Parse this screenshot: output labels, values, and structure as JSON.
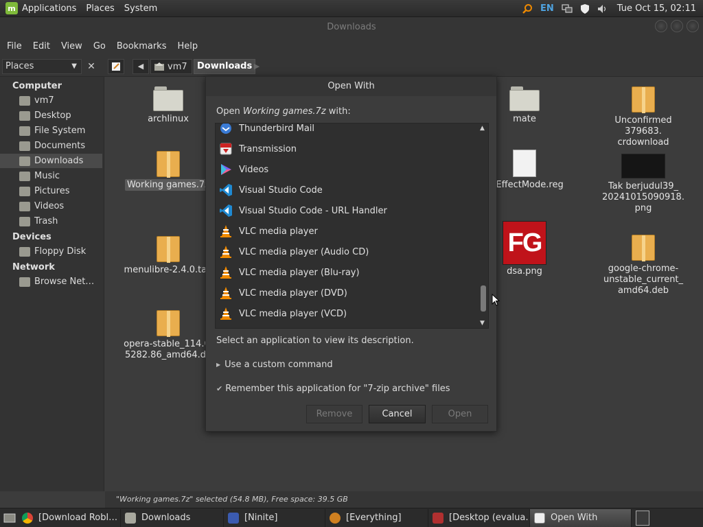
{
  "top_panel": {
    "menus": [
      "Applications",
      "Places",
      "System"
    ],
    "language": "EN",
    "clock": "Tue Oct 15, 02:11"
  },
  "window": {
    "title": "Downloads",
    "menus": [
      "File",
      "Edit",
      "View",
      "Go",
      "Bookmarks",
      "Help"
    ]
  },
  "toolbar": {
    "places_label": "Places",
    "crumb_home": "vm7",
    "crumb_current": "Downloads"
  },
  "sidebar": {
    "computer_heading": "Computer",
    "computer_items": [
      "vm7",
      "Desktop",
      "File System",
      "Documents",
      "Downloads",
      "Music",
      "Pictures",
      "Videos",
      "Trash"
    ],
    "active_item": "Downloads",
    "devices_heading": "Devices",
    "devices_items": [
      "Floppy Disk"
    ],
    "network_heading": "Network",
    "network_items": [
      "Browse Net…"
    ]
  },
  "files": {
    "items": [
      {
        "name": "archlinux",
        "type": "folder"
      },
      {
        "name": "Working games.7z",
        "type": "package",
        "selected": true
      },
      {
        "name": "menulibre-2.4.0.tar.",
        "type": "package"
      },
      {
        "name": "opera-stable_114.0.",
        "name2": "5282.86_amd64.de",
        "type": "package"
      },
      {
        "name": "mate",
        "type": "folder"
      },
      {
        "name": "ceEffectMode.reg",
        "type": "document"
      },
      {
        "name": "dsa.png",
        "type": "image-fg",
        "image_text": "FG"
      },
      {
        "name": "Unconfirmed 379683.",
        "name2": "crdownload",
        "type": "package"
      },
      {
        "name": "Tak berjudul39_",
        "name2": "20241015090918.",
        "name3": "png",
        "type": "image-dark"
      },
      {
        "name": "google-chrome-",
        "name2": "unstable_current_",
        "name3": "amd64.deb",
        "type": "package"
      }
    ]
  },
  "status": "\"Working games.7z\" selected (54.8 MB), Free space: 39.5 GB",
  "dialog": {
    "title": "Open With",
    "prompt_prefix": "Open ",
    "prompt_file": "Working games.7z",
    "prompt_suffix": " with:",
    "apps": [
      {
        "label": "Thunderbird Mail",
        "icon": "thunderbird-icon"
      },
      {
        "label": "Transmission",
        "icon": "transmission-icon"
      },
      {
        "label": "Videos",
        "icon": "videos-icon"
      },
      {
        "label": "Visual Studio Code",
        "icon": "vscode-icon"
      },
      {
        "label": "Visual Studio Code - URL Handler",
        "icon": "vscode-icon"
      },
      {
        "label": "VLC media player",
        "icon": "vlc-icon"
      },
      {
        "label": "VLC media player (Audio CD)",
        "icon": "vlc-icon"
      },
      {
        "label": "VLC media player (Blu-ray)",
        "icon": "vlc-icon"
      },
      {
        "label": "VLC media player (DVD)",
        "icon": "vlc-icon"
      },
      {
        "label": "VLC media player (VCD)",
        "icon": "vlc-icon"
      }
    ],
    "description": "Select an application to view its description.",
    "custom_command": "Use a custom command",
    "remember": "Remember this application for \"7-zip archive\" files",
    "buttons": {
      "remove": "Remove",
      "cancel": "Cancel",
      "open": "Open"
    }
  },
  "taskbar": {
    "items": [
      {
        "label": "[Download Robl…",
        "icon": "chrome-icon"
      },
      {
        "label": "Downloads",
        "icon": "folder-icon"
      },
      {
        "label": "[Ninite]",
        "icon": "ninite-icon"
      },
      {
        "label": "[Everything]",
        "icon": "everything-icon"
      },
      {
        "label": "[Desktop (evalua…",
        "icon": "rdp-icon"
      },
      {
        "label": "Open With",
        "icon": "dialog-icon",
        "active": true
      }
    ]
  },
  "colors": {
    "accent_blue": "#4fa3e0",
    "mint_green": "#7fba3a",
    "vlc_orange": "#f08a00",
    "package_orange": "#e9ae4e"
  }
}
